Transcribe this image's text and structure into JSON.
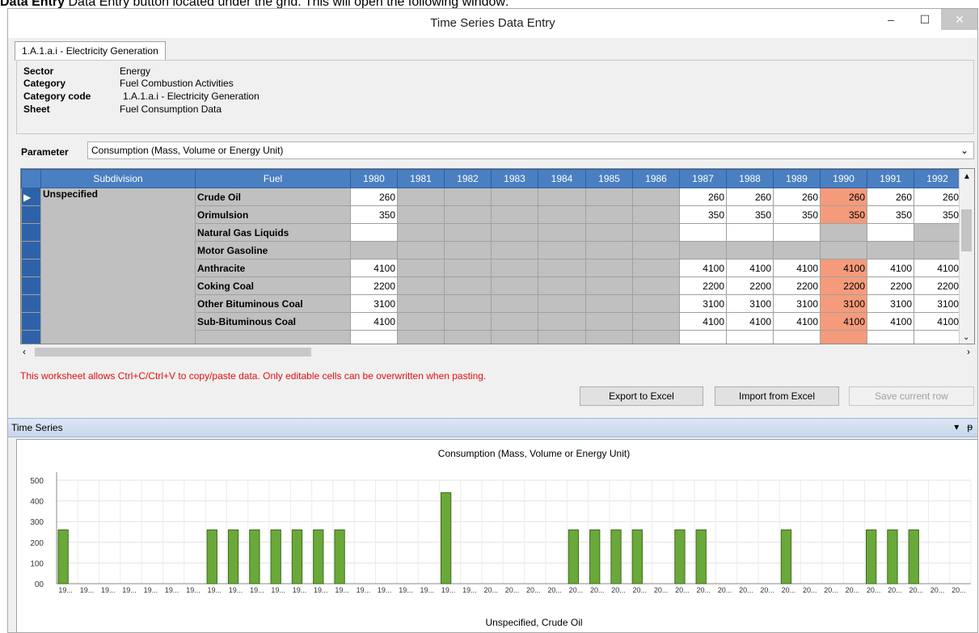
{
  "doc_text": "Data Entry button located under the grid. This will open the following window:",
  "window": {
    "title": "Time Series Data Entry",
    "min_glyph": "–",
    "max_glyph": "☐",
    "close_glyph": "✕"
  },
  "tab": {
    "label": "1.A.1.a.i - Electricity Generation"
  },
  "info": {
    "sector_label": "Sector",
    "sector_value": "Energy",
    "category_label": "Category",
    "category_value": "Fuel Combustion Activities",
    "code_label": "Category code",
    "code_value": "1.A.1.a.i - Electricity Generation",
    "sheet_label": "Sheet",
    "sheet_value": "Fuel Consumption Data"
  },
  "parameter": {
    "label": "Parameter",
    "value": "Consumption (Mass, Volume or Energy Unit)"
  },
  "grid": {
    "subdivision_header": "Subdivision",
    "fuel_header": "Fuel",
    "years": [
      "1980",
      "1981",
      "1982",
      "1983",
      "1984",
      "1985",
      "1986",
      "1987",
      "1988",
      "1989",
      "1990",
      "1991",
      "1992"
    ],
    "subdivision": "Unspecified",
    "rows": [
      {
        "fuel": "Crude Oil",
        "cells": [
          "260",
          "",
          "",
          "",
          "",
          "",
          "",
          "260",
          "260",
          "260",
          "260",
          "260",
          "260"
        ]
      },
      {
        "fuel": "Orimulsion",
        "cells": [
          "350",
          "",
          "",
          "",
          "",
          "",
          "",
          "350",
          "350",
          "350",
          "350",
          "350",
          "350"
        ]
      },
      {
        "fuel": "Natural Gas Liquids",
        "cells": [
          "",
          "",
          "",
          "",
          "",
          "",
          "",
          "",
          "",
          "",
          "",
          "",
          ""
        ]
      },
      {
        "fuel": "Motor Gasoline",
        "cells": [
          "",
          "",
          "",
          "",
          "",
          "",
          "",
          "",
          "",
          "",
          "",
          "",
          ""
        ]
      },
      {
        "fuel": "Anthracite",
        "cells": [
          "4100",
          "",
          "",
          "",
          "",
          "",
          "",
          "4100",
          "4100",
          "4100",
          "4100",
          "4100",
          "4100"
        ]
      },
      {
        "fuel": "Coking Coal",
        "cells": [
          "2200",
          "",
          "",
          "",
          "",
          "",
          "",
          "2200",
          "2200",
          "2200",
          "2200",
          "2200",
          "2200"
        ]
      },
      {
        "fuel": "Other Bituminous Coal",
        "cells": [
          "3100",
          "",
          "",
          "",
          "",
          "",
          "",
          "3100",
          "3100",
          "3100",
          "3100",
          "3100",
          "3100"
        ]
      },
      {
        "fuel": "Sub-Bituminous Coal",
        "cells": [
          "4100",
          "",
          "",
          "",
          "",
          "",
          "",
          "4100",
          "4100",
          "4100",
          "4100",
          "4100",
          "4100"
        ]
      },
      {
        "fuel": "",
        "cells": [
          "",
          "",
          "",
          "",
          "",
          "",
          "",
          "",
          "",
          "",
          "",
          "",
          ""
        ]
      }
    ],
    "cell_styles": [
      [
        "w",
        "g",
        "g",
        "g",
        "g",
        "g",
        "g",
        "w",
        "w",
        "w",
        "h",
        "w",
        "w"
      ],
      [
        "w",
        "g",
        "g",
        "g",
        "g",
        "g",
        "g",
        "w",
        "w",
        "w",
        "h",
        "w",
        "w"
      ],
      [
        "w",
        "g",
        "g",
        "g",
        "g",
        "g",
        "g",
        "w",
        "w",
        "w",
        "g",
        "w",
        "g"
      ],
      [
        "g",
        "g",
        "g",
        "g",
        "g",
        "g",
        "g",
        "g",
        "g",
        "g",
        "g",
        "g",
        "g"
      ],
      [
        "w",
        "g",
        "g",
        "g",
        "g",
        "g",
        "g",
        "w",
        "w",
        "w",
        "h",
        "w",
        "w"
      ],
      [
        "w",
        "g",
        "g",
        "g",
        "g",
        "g",
        "g",
        "w",
        "w",
        "w",
        "h",
        "w",
        "w"
      ],
      [
        "w",
        "g",
        "g",
        "g",
        "g",
        "g",
        "g",
        "w",
        "w",
        "w",
        "h",
        "w",
        "w"
      ],
      [
        "w",
        "g",
        "g",
        "g",
        "g",
        "g",
        "g",
        "w",
        "w",
        "w",
        "h",
        "w",
        "w"
      ],
      [
        "w",
        "g",
        "g",
        "g",
        "g",
        "g",
        "g",
        "w",
        "w",
        "w",
        "h",
        "w",
        "w"
      ]
    ]
  },
  "notice": "This worksheet allows Ctrl+C/Ctrl+V to copy/paste data. Only editable cells can be overwritten when pasting.",
  "buttons": {
    "export": "Export to Excel",
    "import": "Import from Excel",
    "save": "Save current row"
  },
  "panel": {
    "title": "Time Series",
    "menu_glyph": "▾",
    "pin_glyph": "ᵽ"
  },
  "colors": {
    "header_blue": "#4a7fc1",
    "highlight": "#f59b7b",
    "bar_fill": "#6aa83a",
    "bar_stroke": "#3d6b1c",
    "notice_red": "#e01010"
  },
  "chart_data": {
    "type": "bar",
    "title": "Consumption (Mass, Volume or Energy Unit)",
    "xlabel": "Unspecified, Crude Oil",
    "ylabel": "",
    "ylim": [
      0,
      500
    ],
    "y_ticks": [
      "500",
      "400",
      "300",
      "200",
      "100",
      "00"
    ],
    "categories": [
      "19...",
      "19...",
      "19...",
      "19...",
      "19...",
      "19...",
      "19...",
      "19...",
      "19...",
      "19...",
      "19...",
      "19...",
      "19...",
      "19...",
      "19...",
      "19...",
      "19...",
      "19...",
      "19...",
      "19...",
      "20...",
      "20...",
      "20...",
      "20...",
      "20...",
      "20...",
      "20...",
      "20...",
      "20...",
      "20...",
      "20...",
      "20...",
      "20...",
      "20...",
      "20...",
      "20...",
      "20...",
      "20...",
      "20...",
      "20...",
      "20...",
      "20...",
      "20..."
    ],
    "values": [
      260,
      0,
      0,
      0,
      0,
      0,
      0,
      260,
      260,
      260,
      260,
      260,
      260,
      260,
      0,
      0,
      0,
      0,
      440,
      0,
      0,
      0,
      0,
      0,
      260,
      260,
      260,
      260,
      0,
      260,
      260,
      0,
      0,
      0,
      260,
      0,
      0,
      0,
      260,
      260,
      260,
      0,
      0
    ]
  }
}
